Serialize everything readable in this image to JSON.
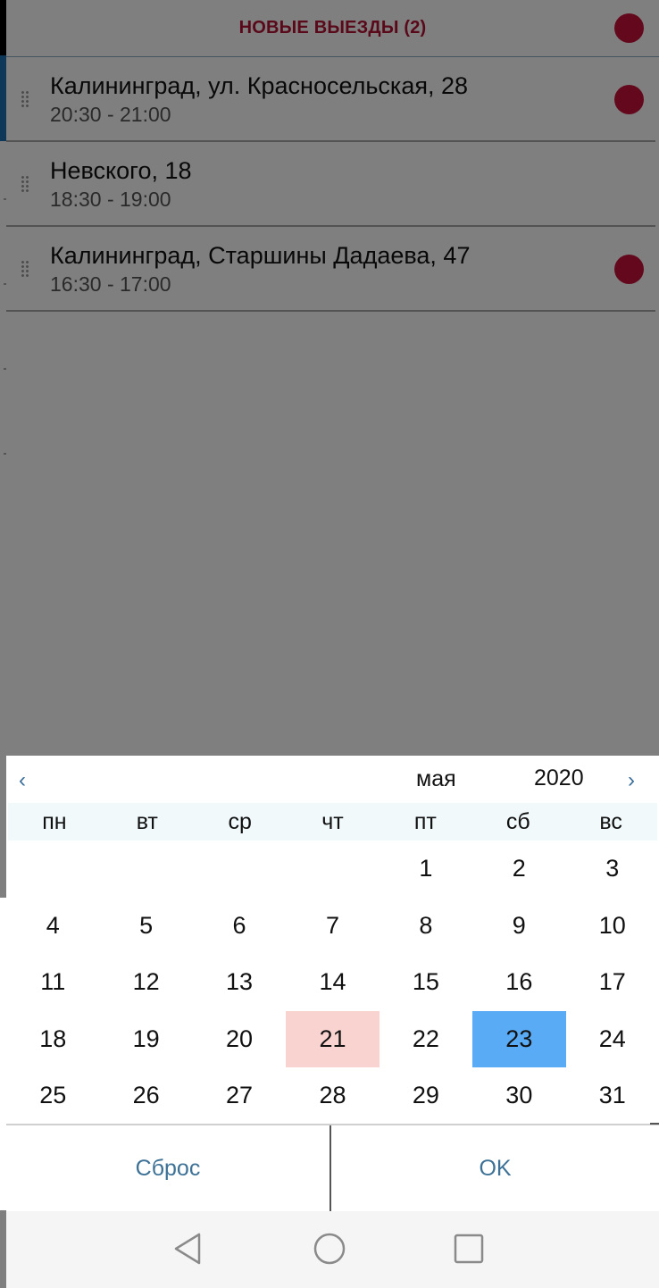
{
  "list": {
    "section_title": "НОВЫЕ ВЫЕЗДЫ (2)",
    "items": [
      {
        "address": "Калининград, ул. Красносельская, 28",
        "time": "20:30 - 21:00",
        "new": true
      },
      {
        "address": "Невского, 18",
        "time": "18:30 - 19:00",
        "new": false
      },
      {
        "address": "Калининград, Старшины Дадаева, 47",
        "time": "16:30 - 17:00",
        "new": true
      }
    ]
  },
  "picker": {
    "prev_icon": "‹",
    "next_icon": "›",
    "month": "мая",
    "year": "2020",
    "weekdays": [
      "пн",
      "вт",
      "ср",
      "чт",
      "пт",
      "сб",
      "вс"
    ],
    "weeks": [
      [
        "",
        "",
        "",
        "",
        "1",
        "2",
        "3"
      ],
      [
        "4",
        "5",
        "6",
        "7",
        "8",
        "9",
        "10"
      ],
      [
        "11",
        "12",
        "13",
        "14",
        "15",
        "16",
        "17"
      ],
      [
        "18",
        "19",
        "20",
        "21",
        "22",
        "23",
        "24"
      ],
      [
        "25",
        "26",
        "27",
        "28",
        "29",
        "30",
        "31"
      ]
    ],
    "today": "21",
    "selected": "23",
    "reset_label": "Сброс",
    "ok_label": "OK"
  },
  "colors": {
    "accent_red": "#c8123a",
    "today_highlight": "#f8d3d0",
    "selected_highlight": "#5aabf5",
    "button_text": "#3d7296"
  },
  "navbar": {
    "back_icon": "triangle-back-icon",
    "home_icon": "circle-home-icon",
    "recent_icon": "square-recent-icon"
  }
}
